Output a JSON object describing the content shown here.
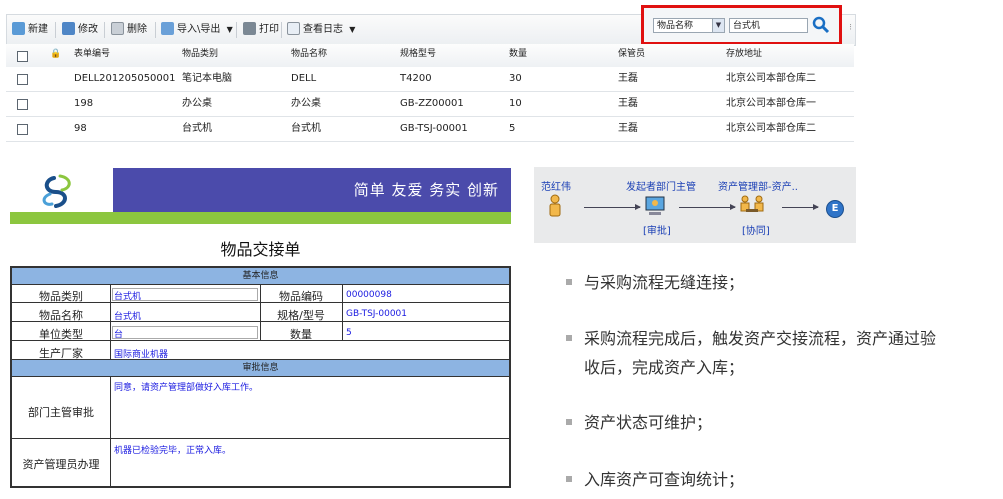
{
  "toolbar": {
    "new_label": "新建",
    "edit_label": "修改",
    "delete_label": "删除",
    "import_export_label": "导入\\导出",
    "print_label": "打印",
    "view_log_label": "查看日志",
    "search_field": "物品名称",
    "search_value": "台式机"
  },
  "grid": {
    "headers": [
      "表单编号",
      "物品类别",
      "物品名称",
      "规格型号",
      "数量",
      "保管员",
      "存放地址"
    ],
    "rows": [
      [
        "DELL201205050001",
        "笔记本电脑",
        "DELL",
        "T4200",
        "30",
        "王磊",
        "北京公司本部仓库二"
      ],
      [
        "198",
        "办公桌",
        "办公桌",
        "GB-ZZ00001",
        "10",
        "王磊",
        "北京公司本部仓库一"
      ],
      [
        "98",
        "台式机",
        "台式机",
        "GB-TSJ-00001",
        "5",
        "王磊",
        "北京公司本部仓库二"
      ]
    ]
  },
  "banner": {
    "slogan": "简单 友爱 务实 创新"
  },
  "form": {
    "title": "物品交接单",
    "basic_section": "基本信息",
    "category_label": "物品类别",
    "category_value": "台式机",
    "code_label": "物品编码",
    "code_value": "00000098",
    "name_label": "物品名称",
    "name_value": "台式机",
    "spec_label": "规格/型号",
    "spec_value": "GB-TSJ-00001",
    "unit_label": "单位类型",
    "unit_value": "台",
    "qty_label": "数量",
    "qty_value": "5",
    "maker_label": "生产厂家",
    "maker_value": "国际商业机器",
    "approval_section": "审批信息",
    "dept_label": "部门主管审批",
    "dept_value": "同意，请资产管理部做好入库工作。",
    "asset_label": "资产管理员办理",
    "asset_value": "机器已检验完毕，正常入库。"
  },
  "flow": {
    "node1_name": "范红伟",
    "node2_name": "发起者部门主管",
    "node2_action": "[审批]",
    "node3_name": "资产管理部-资产..",
    "node3_action": "[协同]",
    "end_label": "E"
  },
  "bullets": [
    "与采购流程无缝连接；",
    "采购流程完成后，触发资产交接流程，资产通过验收后，完成资产入库；",
    "资产状态可维护；",
    "入库资产可查询统计；"
  ],
  "colors": {
    "highlight_red": "#e01010",
    "banner_blue": "#4b4bab",
    "banner_green": "#8cc63f",
    "section_blue": "#8db4e2",
    "value_blue": "#1a1ae0"
  }
}
